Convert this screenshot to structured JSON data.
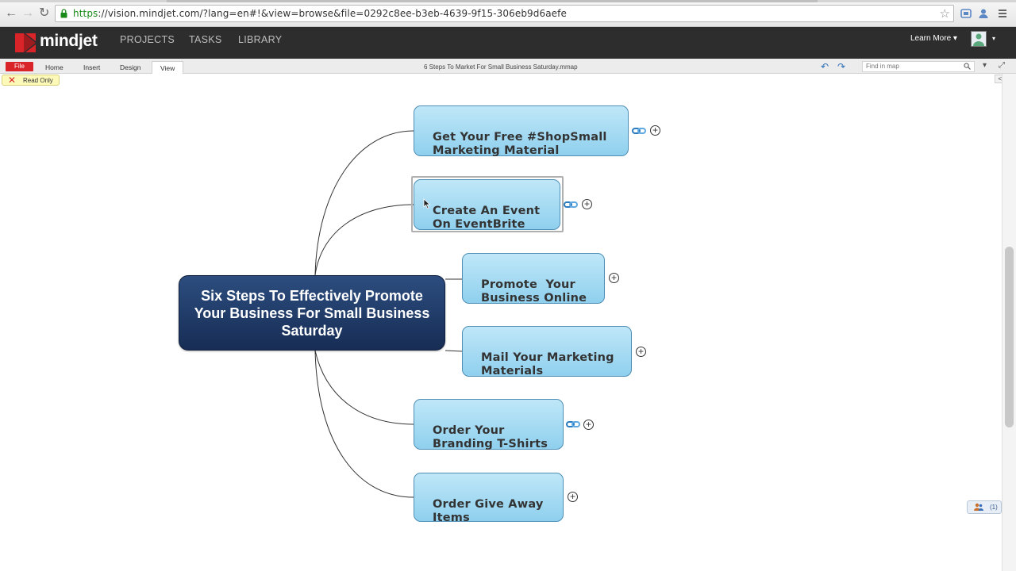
{
  "browser": {
    "url_scheme": "https",
    "url_rest": "://vision.mindjet.com/?lang=en#!&view=browse&file=0292c8ee-b3eb-4639-9f15-306eb9d6aefe",
    "back_glyph": "←",
    "forward_glyph": "→",
    "reload_glyph": "↻",
    "star_glyph": "☆"
  },
  "app": {
    "logo": "mindjet",
    "nav": [
      "PROJECTS",
      "TASKS",
      "LIBRARY"
    ],
    "learn_more": "Learn More ▾",
    "avatar_caret": "▾"
  },
  "ribbon": {
    "file": "File",
    "tabs": [
      "Home",
      "Insert",
      "Design",
      "View"
    ],
    "active_tab": "View",
    "document_title": "6 Steps To Market For Small Business Saturday.mmap",
    "undo_glyph": "↶",
    "redo_glyph": "↷",
    "find_placeholder": "Find in map",
    "dropdown_glyph": "▾",
    "fullscreen_glyph": "⤢"
  },
  "status": {
    "read_only": "Read Only",
    "read_only_icon": "✕",
    "collapse": "<<",
    "chat_count": "(1)"
  },
  "mindmap": {
    "central": "Six Steps To Effectively Promote Your Business For Small Business Saturday",
    "topics": [
      {
        "line1": "Get Your Free #ShopSmall",
        "line2": "Marketing Material",
        "has_link": true
      },
      {
        "line1": "Create An Event",
        "line2": "On EventBrite",
        "has_link": true
      },
      {
        "line1": "Promote  Your",
        "line2": "Business Online",
        "has_link": false
      },
      {
        "line1": "Mail Your Marketing",
        "line2": "Materials",
        "has_link": false
      },
      {
        "line1": "Order Your",
        "line2": "Branding T-Shirts",
        "has_link": true
      },
      {
        "line1": "Order Give Away",
        "line2": "Items",
        "has_link": false
      }
    ],
    "expand_glyph": "+"
  },
  "colors": {
    "appbar": "#2d2d2d",
    "central_fill": "#1f3a66",
    "topic_fill": "#a9dcf3",
    "file_tab": "#d9252a",
    "read_only_bg": "#fdf9b9"
  }
}
